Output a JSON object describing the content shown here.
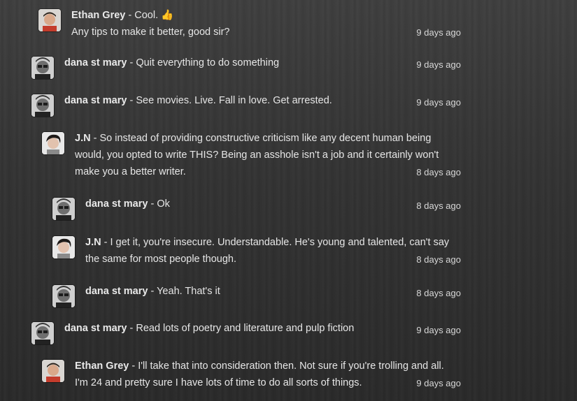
{
  "comments": [
    {
      "author": "Ethan Grey",
      "lines": [
        "Cool. 👍",
        "Any tips to make it better, good sir?"
      ],
      "time": "9 days ago",
      "avatar": "ethan-avatar"
    },
    {
      "author": "dana st mary",
      "lines": [
        "Quit everything to do something"
      ],
      "time": "9 days ago",
      "avatar": "dana-avatar"
    },
    {
      "author": "dana st mary",
      "lines": [
        "See movies. Live. Fall in love. Get arrested."
      ],
      "time": "9 days ago",
      "avatar": "dana-avatar"
    },
    {
      "author": "J.N",
      "lines": [
        "So instead of providing constructive criticism like any decent human being",
        "would, you opted to write THIS? Being an asshole isn't a job and it certainly won't",
        "make you a better writer."
      ],
      "time": "8 days ago",
      "avatar": "jn-avatar"
    },
    {
      "author": "dana st mary",
      "lines": [
        "Ok"
      ],
      "time": "8 days ago",
      "avatar": "dana-avatar"
    },
    {
      "author": "J.N",
      "lines": [
        "I get it, you're insecure. Understandable. He's young and talented, can't say",
        "the same for most people though."
      ],
      "time": "8 days ago",
      "avatar": "jn-avatar"
    },
    {
      "author": "dana st mary",
      "lines": [
        "Yeah. That's it"
      ],
      "time": "8 days ago",
      "avatar": "dana-avatar"
    },
    {
      "author": "dana st mary",
      "lines": [
        "Read lots of poetry and literature and pulp fiction"
      ],
      "time": "9 days ago",
      "avatar": "dana-avatar"
    },
    {
      "author": "Ethan Grey",
      "lines": [
        "I'll take that into consideration then. Not sure if you're trolling and all.",
        "I'm 24 and pretty sure I have lots of time to do all sorts of things."
      ],
      "time": "9 days ago",
      "avatar": "ethan-avatar"
    }
  ],
  "separator": " - ",
  "colors": {
    "background": "#333333",
    "text": "#e6e6e6",
    "author": "#e9e9e9",
    "timestamp": "#d7d7d7"
  }
}
